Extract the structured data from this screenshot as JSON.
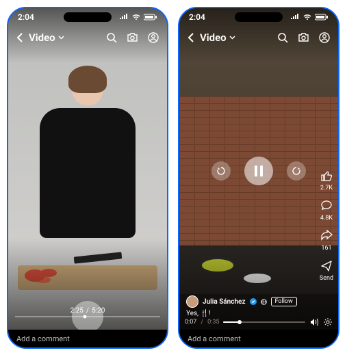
{
  "phone1": {
    "status_time": "2:04",
    "nav_title": "Video",
    "time_elapsed": "2:25",
    "time_total": "5:20",
    "comment_placeholder": "Add a comment"
  },
  "phone2": {
    "status_time": "2:04",
    "nav_title": "Video",
    "author": "Julia Sánchez",
    "follow_label": "Follow",
    "caption": "Yes, 🍴!",
    "time_elapsed": "0:07",
    "time_total": "0:35",
    "likes": "2.7K",
    "comments": "4.8K",
    "shares": "161",
    "send_label": "Send",
    "comment_placeholder": "Add a comment",
    "progress_percent": 20
  }
}
